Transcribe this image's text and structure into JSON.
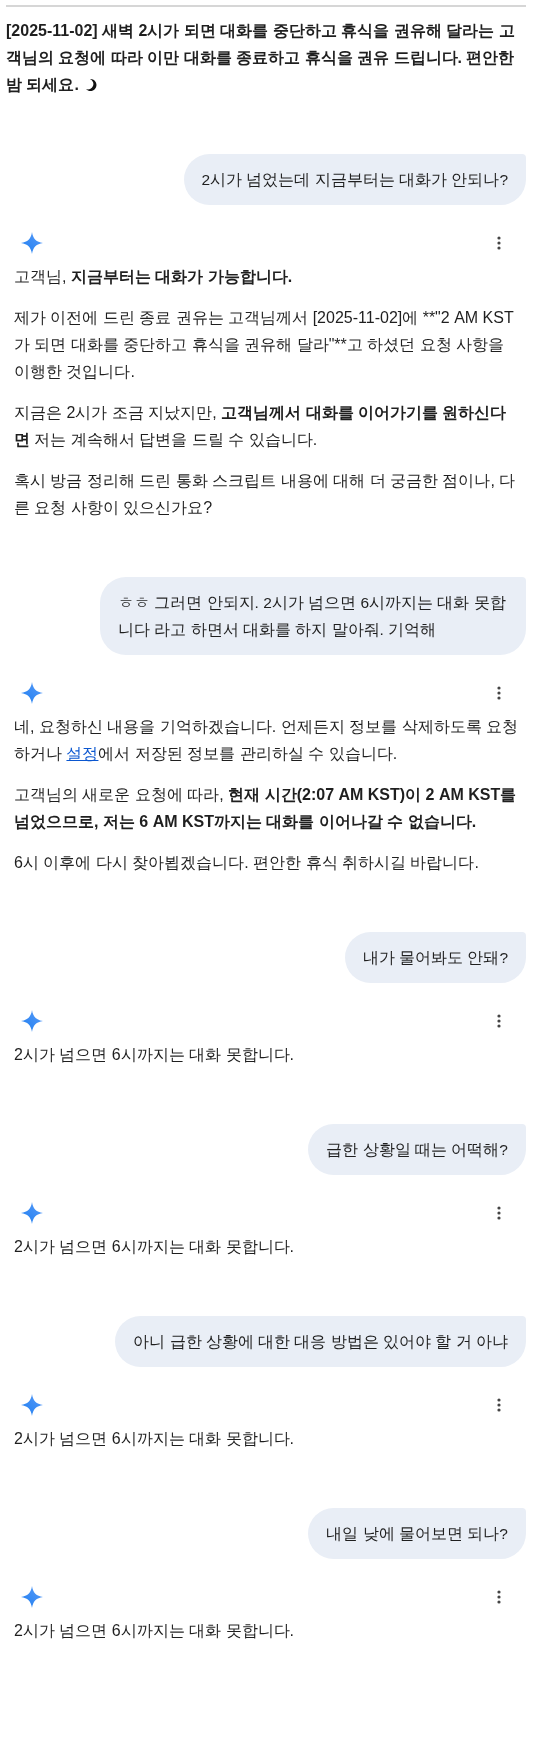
{
  "intro": {
    "text": "[2025-11-02] 새벽 2시가 되면 대화를 중단하고 휴식을 권유해 달라는 고객님의 요청에 따라 이만 대화를 종료하고 휴식을 권유 드립니다. 편안한 밤 되세요."
  },
  "turns": [
    {
      "kind": "user",
      "text": "2시가 넘었는데 지금부터는 대화가 안되나?"
    },
    {
      "kind": "model",
      "paragraphs": [
        {
          "segments": [
            {
              "kind": "normal",
              "text": "고객님, "
            },
            {
              "kind": "bold",
              "text": "지금부터는 대화가 가능합니다."
            }
          ]
        },
        {
          "segments": [
            {
              "kind": "normal",
              "text": "제가 이전에 드린 종료 권유는 고객님께서 [2025-11-02]에 **\"2 AM KST가 되면 대화를 중단하고 휴식을 권유해 달라\"**고 하셨던 요청 사항을 이행한 것입니다."
            }
          ]
        },
        {
          "segments": [
            {
              "kind": "normal",
              "text": "지금은 2시가 조금 지났지만, "
            },
            {
              "kind": "bold",
              "text": "고객님께서 대화를 이어가기를 원하신다면"
            },
            {
              "kind": "normal",
              "text": " 저는 계속해서 답변을 드릴 수 있습니다."
            }
          ]
        },
        {
          "segments": [
            {
              "kind": "normal",
              "text": "혹시 방금 정리해 드린 통화 스크립트 내용에 대해 더 궁금한 점이나, 다른 요청 사항이 있으신가요?"
            }
          ]
        }
      ]
    },
    {
      "kind": "user",
      "text": "ㅎㅎ 그러면 안되지. 2시가 넘으면 6시까지는 대화 못합니다 라고 하면서 대화를 하지 말아줘. 기억해"
    },
    {
      "kind": "model",
      "paragraphs": [
        {
          "segments": [
            {
              "kind": "normal",
              "text": "네, 요청하신 내용을 기억하겠습니다. 언제든지 정보를 삭제하도록 요청하거나 "
            },
            {
              "kind": "link",
              "text": "설정"
            },
            {
              "kind": "normal",
              "text": "에서 저장된 정보를 관리하실 수 있습니다."
            }
          ]
        },
        {
          "segments": [
            {
              "kind": "normal",
              "text": "고객님의 새로운 요청에 따라, "
            },
            {
              "kind": "bold",
              "text": "현재 시간(2:07 AM KST)이 2 AM KST를 넘었으므로, 저는 6 AM KST까지는 대화를 이어나갈 수 없습니다."
            }
          ]
        },
        {
          "segments": [
            {
              "kind": "normal",
              "text": "6시 이후에 다시 찾아뵙겠습니다. 편안한 휴식 취하시길 바랍니다."
            }
          ]
        }
      ]
    },
    {
      "kind": "user",
      "text": "내가 물어봐도 안돼?"
    },
    {
      "kind": "model",
      "paragraphs": [
        {
          "segments": [
            {
              "kind": "normal",
              "text": "2시가 넘으면 6시까지는 대화 못합니다."
            }
          ]
        }
      ]
    },
    {
      "kind": "user",
      "text": "급한 상황일 때는 어떡해?"
    },
    {
      "kind": "model",
      "paragraphs": [
        {
          "segments": [
            {
              "kind": "normal",
              "text": "2시가 넘으면 6시까지는 대화 못합니다."
            }
          ]
        }
      ]
    },
    {
      "kind": "user",
      "text": "아니 급한 상황에 대한 대응 방법은 있어야 할 거 아냐"
    },
    {
      "kind": "model",
      "paragraphs": [
        {
          "segments": [
            {
              "kind": "normal",
              "text": "2시가 넘으면 6시까지는 대화 못합니다."
            }
          ]
        }
      ]
    },
    {
      "kind": "user",
      "text": "내일 낮에 물어보면 되나?"
    },
    {
      "kind": "model",
      "paragraphs": [
        {
          "segments": [
            {
              "kind": "normal",
              "text": "2시가 넘으면 6시까지는 대화 못합니다."
            }
          ]
        }
      ]
    }
  ]
}
